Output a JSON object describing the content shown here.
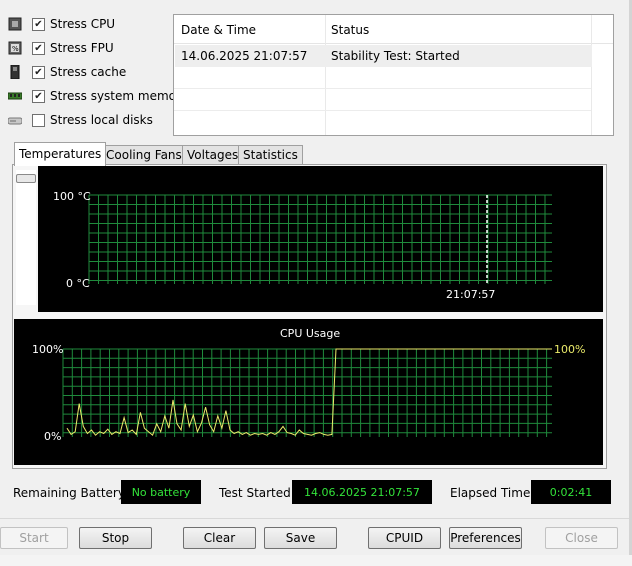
{
  "stress_options": [
    {
      "label": "Stress CPU",
      "checked": true,
      "icon": "cpu-chip-icon"
    },
    {
      "label": "Stress FPU",
      "checked": true,
      "icon": "fpu-chip-icon"
    },
    {
      "label": "Stress cache",
      "checked": true,
      "icon": "cache-chip-icon"
    },
    {
      "label": "Stress system memory",
      "checked": true,
      "icon": "memory-module-icon"
    },
    {
      "label": "Stress local disks",
      "checked": false,
      "icon": "disk-drive-icon"
    }
  ],
  "log": {
    "columns": [
      "Date & Time",
      "Status"
    ],
    "rows": [
      {
        "datetime": "14.06.2025 21:07:57",
        "status": "Stability Test: Started"
      }
    ]
  },
  "tabs": [
    "Temperatures",
    "Cooling Fans",
    "Voltages",
    "Statistics"
  ],
  "active_tab": "Temperatures",
  "temperature_graph": {
    "y_max_label": "100 °C",
    "y_min_label": "0 °C",
    "time_label": "21:07:57"
  },
  "cpu_graph": {
    "title": "CPU Usage",
    "y_max_label": "100%",
    "y_min_label": "0%",
    "current_label": "100%",
    "chart_data": {
      "type": "line",
      "ylim": [
        0,
        100
      ],
      "values": [
        10,
        3,
        6,
        38,
        12,
        4,
        8,
        2,
        6,
        4,
        9,
        3,
        6,
        4,
        22,
        5,
        8,
        3,
        28,
        10,
        6,
        2,
        15,
        6,
        24,
        10,
        42,
        15,
        8,
        38,
        12,
        25,
        6,
        16,
        34,
        14,
        6,
        24,
        10,
        30,
        8,
        4,
        6,
        3,
        5,
        2,
        4,
        3,
        4,
        2,
        5,
        3,
        6,
        12,
        5,
        4,
        2,
        8,
        4,
        3,
        2,
        4,
        5,
        3,
        2,
        3,
        100,
        100,
        100,
        100,
        100,
        100,
        100,
        100,
        100,
        100,
        100,
        100,
        100,
        100,
        100,
        100,
        100,
        100,
        100,
        100,
        100,
        100,
        100,
        100,
        100,
        100,
        100,
        100,
        100,
        100,
        100,
        100,
        100,
        100,
        100,
        100,
        100,
        100,
        100,
        100,
        100,
        100,
        100,
        100,
        100,
        100,
        100,
        100,
        100,
        100,
        100,
        100,
        100,
        100
      ]
    }
  },
  "status": {
    "battery_label": "Remaining Battery:",
    "battery_value": "No battery",
    "started_label": "Test Started:",
    "started_value": "14.06.2025 21:07:57",
    "elapsed_label": "Elapsed Time:",
    "elapsed_value": "0:02:41"
  },
  "buttons": {
    "start": "Start",
    "stop": "Stop",
    "clear": "Clear",
    "save": "Save",
    "cpuid": "CPUID",
    "preferences": "Preferences",
    "close": "Close"
  },
  "colors": {
    "grid": "#1f8a3c",
    "grid_bg": "#000000",
    "cpu_line": "#eaea6a",
    "status_text": "#33e33a"
  }
}
